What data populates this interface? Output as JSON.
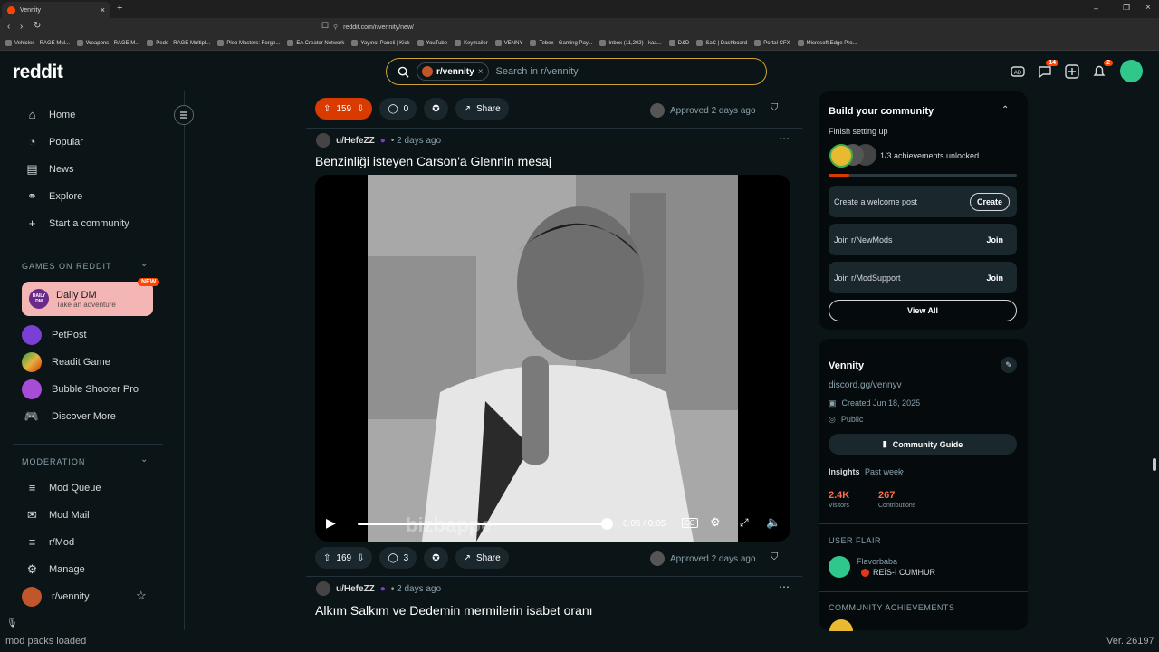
{
  "browser": {
    "tab_title": "Vennity",
    "url": "reddit.com/r/vennity/new/",
    "bookmarks": [
      "Vehicles - RAGE Mul...",
      "Weapons - RAGE M...",
      "Peds - RAGE Multipl...",
      "Pleb Masters: Forge...",
      "EA Creator Network",
      "Yayıncı Paneli | Kick",
      "YouTube",
      "Keymailer",
      "VENNY",
      "Tebex - Gaming Pay...",
      "Inbox (11,202) - kaa...",
      "D&D",
      "SaC | Dashboard",
      "Portal CFX",
      "Microsoft Edge Pro..."
    ]
  },
  "header": {
    "logo": "reddit",
    "search_chip": "r/vennity",
    "search_placeholder": "Search in r/vennity",
    "chat_badge": "14",
    "notif_badge": "2"
  },
  "nav": {
    "items": [
      "Home",
      "Popular",
      "News",
      "Explore",
      "Start a community"
    ],
    "games_title": "GAMES ON REDDIT",
    "daily_dm": {
      "title": "Daily DM",
      "subtitle": "Take an adventure",
      "badge": "NEW",
      "logo_text": "DAILY DM"
    },
    "games": [
      "PetPost",
      "Readit Game",
      "Bubble Shooter Pro",
      "Discover More"
    ],
    "mod_title": "MODERATION",
    "mod_items": [
      "Mod Queue",
      "Mod Mail",
      "r/Mod",
      "Manage"
    ],
    "community": "r/vennity"
  },
  "feed": {
    "top_post": {
      "votes": "159",
      "comments": "0",
      "share": "Share",
      "approved": "Approved 2 days ago"
    },
    "post1": {
      "author": "u/HefeZZ",
      "time": "• 2 days ago",
      "title": "Benzinliği isteyen Carson'a Glennin mesaj",
      "video_time": "0:05 / 0:05",
      "progress": 1.0,
      "watermark": "bizbappe",
      "votes": "169",
      "comments": "3",
      "share": "Share",
      "approved": "Approved 2 days ago"
    },
    "post2": {
      "author": "u/HefeZZ",
      "time": "• 2 days ago",
      "title": "Alkım Salkım ve Dedemin mermilerin isabet oranı"
    }
  },
  "sidebar": {
    "build": {
      "title": "Build your community",
      "subtitle": "Finish setting up",
      "achievements": "1/3 achievements unlocked",
      "progress": 0.33,
      "tasks": [
        {
          "label": "Create a welcome post",
          "action": "Create"
        },
        {
          "label": "Join r/NewMods",
          "action": "Join"
        },
        {
          "label": "Join r/ModSupport",
          "action": "Join"
        }
      ],
      "view_all": "View All"
    },
    "about": {
      "name": "Vennity",
      "link": "discord.gg/vennyv",
      "created": "Created Jun 18, 2025",
      "visibility": "Public",
      "guide": "Community Guide",
      "insights": "Insights",
      "period": "Past week",
      "visitors_value": "2.4K",
      "visitors_label": "Visitors",
      "contrib_value": "267",
      "contrib_label": "Contributions"
    },
    "flair_title": "USER FLAIR",
    "flair_user": "Flavorbaba",
    "flair_text": "REİS-İ CUMHUR",
    "achievements_title": "COMMUNITY ACHIEVEMENTS"
  },
  "status": {
    "left": "mod packs loaded",
    "right": "Ver. 26197"
  },
  "colors": {
    "accent": "#ff4500",
    "search_border": "#d4a23b",
    "bg": "#0b1416"
  }
}
